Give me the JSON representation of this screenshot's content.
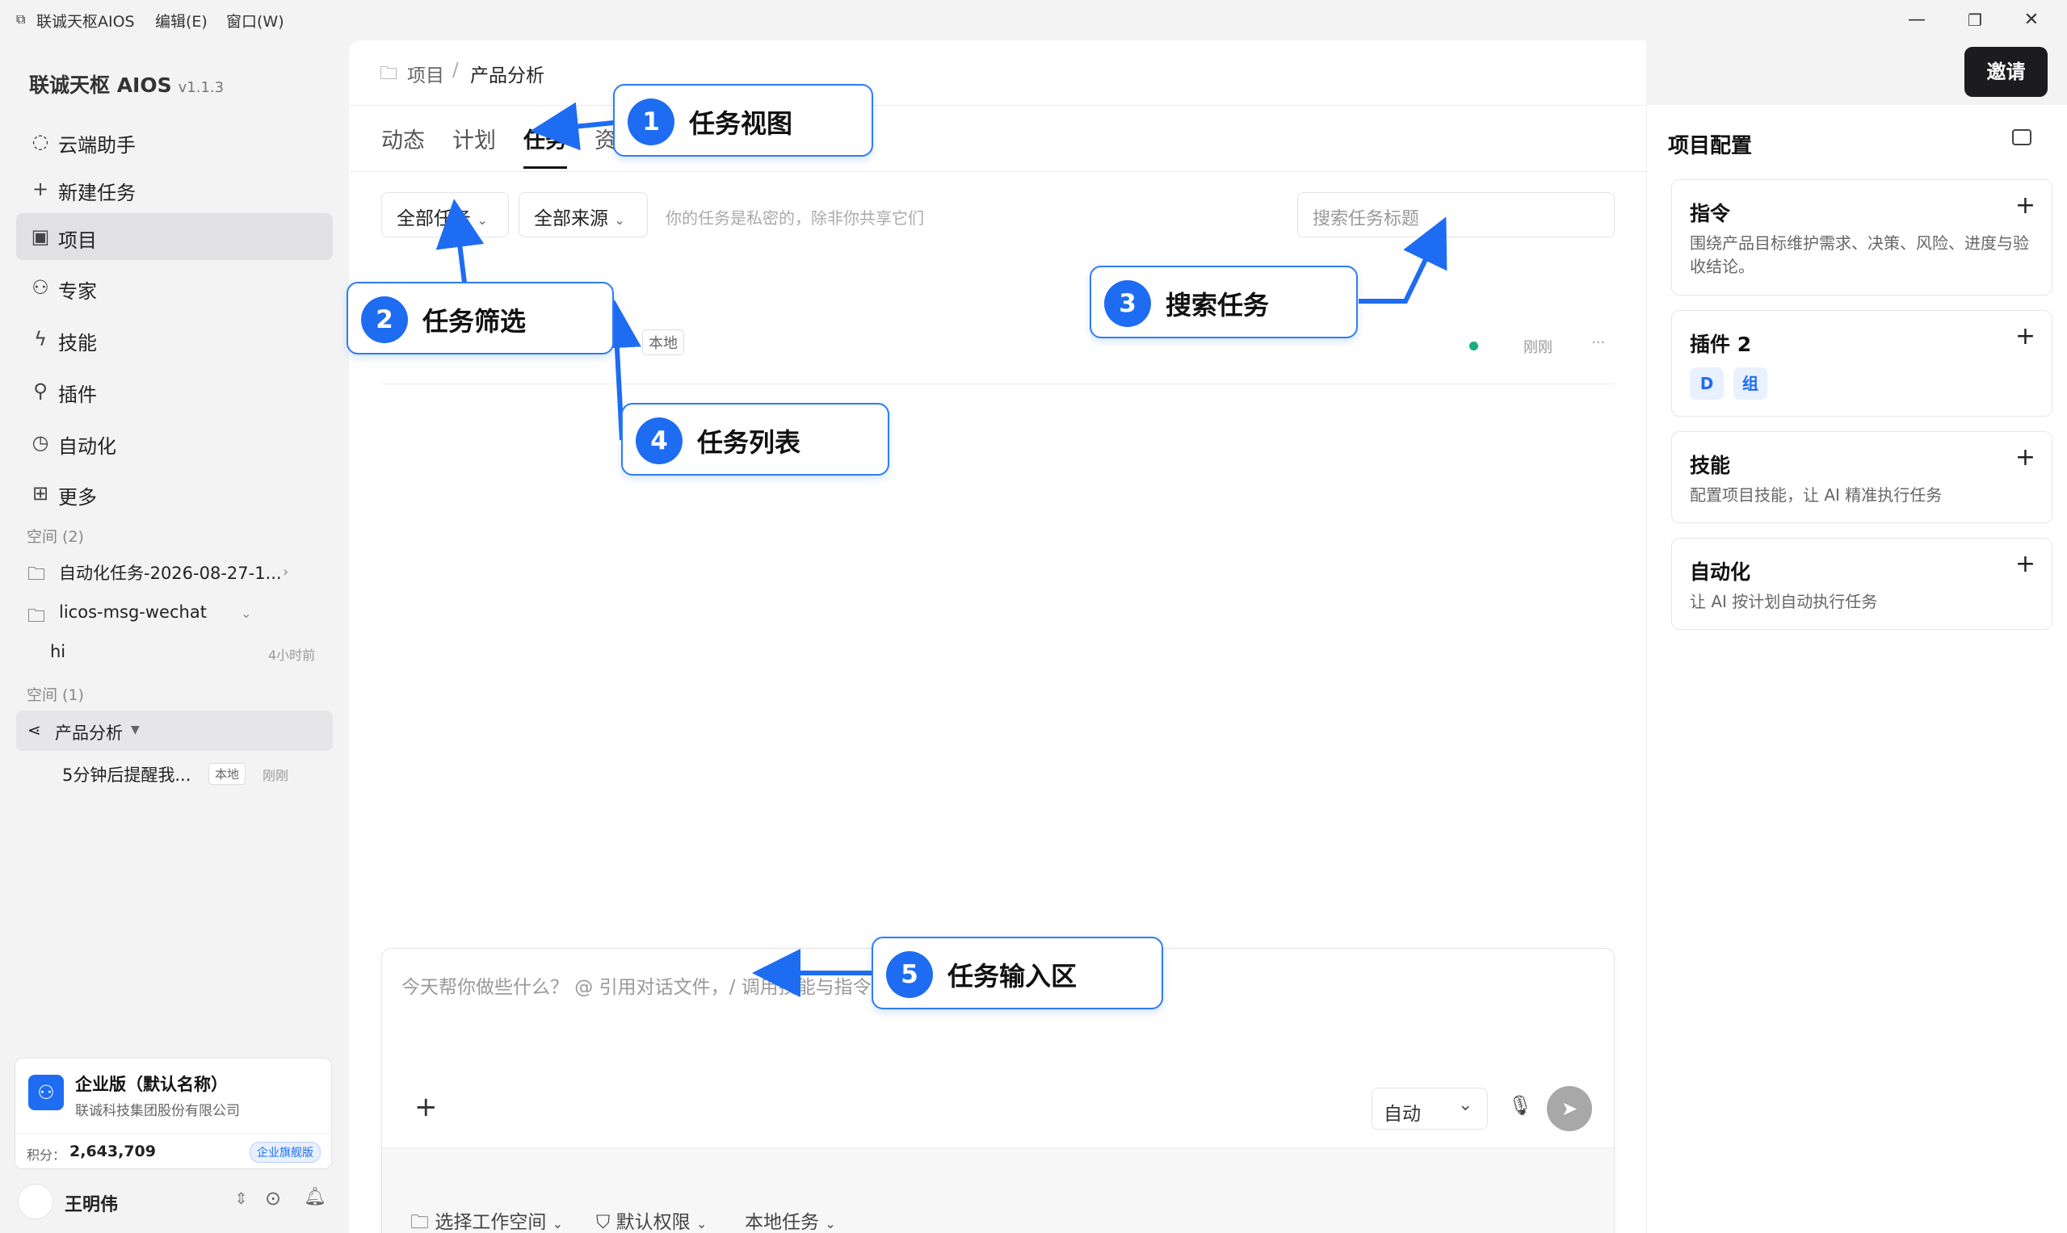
{
  "menubar": {
    "app_title": "联诚天枢AIOS",
    "edit": "编辑(E)",
    "window": "窗口(W)"
  },
  "sidebar": {
    "brand": "联诚天枢 AIOS",
    "version": "v1.1.3",
    "nav": [
      "云端助手",
      "新建任务",
      "项目",
      "专家",
      "技能",
      "插件",
      "自动化",
      "更多"
    ],
    "section1": "空间 (2)",
    "space1": "自动化任务-2026-08-27-1...",
    "space2": "licos-msg-wechat",
    "chat_hi": "hi",
    "chat_hi_time": "4小时前",
    "section2": "空间 (1)",
    "project": "产品分析",
    "task": "5分钟后提醒我...",
    "task_tag": "本地",
    "task_time": "刚刚"
  },
  "enterprise": {
    "name": "企业版（默认名称）",
    "company": "联诚科技集团股份有限公司",
    "points_label": "积分：",
    "points": "2,643,709",
    "badge": "企业旗舰版"
  },
  "user": {
    "name": "王明伟"
  },
  "header": {
    "breadcrumb_root": "项目",
    "breadcrumb_sep": "/",
    "breadcrumb_current": "产品分析",
    "invite": "邀请"
  },
  "tabs": [
    "动态",
    "计划",
    "任务",
    "资"
  ],
  "filters": {
    "all_tasks": "全部任务",
    "all_sources": "全部来源",
    "hint": "你的任务是私密的，除非你共享它们",
    "search_placeholder": "搜索任务标题"
  },
  "task_row": {
    "tag": "本地",
    "time": "刚刚",
    "more": "···"
  },
  "input": {
    "placeholder": "今天帮你做些什么？ @ 引用对话文件，/ 调用技能与指令",
    "mode": "自动",
    "opt_workspace": "选择工作空间",
    "opt_permission": "默认权限",
    "opt_local": "本地任务"
  },
  "right_panel": {
    "title": "项目配置",
    "cards": [
      {
        "title": "指令",
        "desc": "围绕产品目标维护需求、决策、风险、进度与验收结论。"
      },
      {
        "title": "插件 2",
        "chip1": "D",
        "chip2": "组"
      },
      {
        "title": "技能",
        "desc": "配置项目技能，让 AI 精准执行任务"
      },
      {
        "title": "自动化",
        "desc": "让 AI 按计划自动执行任务"
      }
    ]
  },
  "callouts": [
    {
      "num": "1",
      "text": "任务视图"
    },
    {
      "num": "2",
      "text": "任务筛选"
    },
    {
      "num": "3",
      "text": "搜索任务"
    },
    {
      "num": "4",
      "text": "任务列表"
    },
    {
      "num": "5",
      "text": "任务输入区"
    }
  ],
  "colors": {
    "accent": "#1e6cf2",
    "invite_bg": "#1c1c1e",
    "status_dot": "#16b07a"
  }
}
